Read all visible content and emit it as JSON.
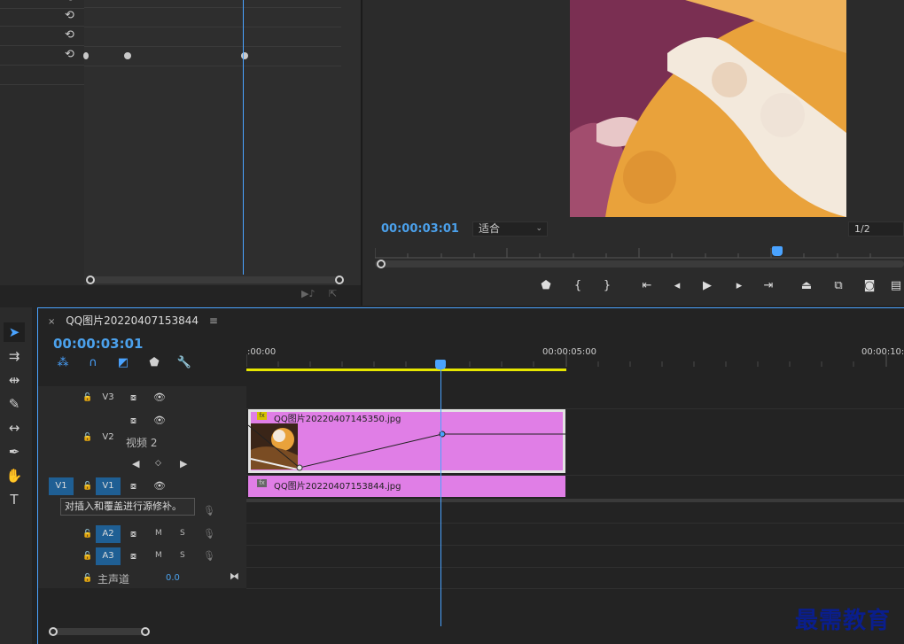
{
  "effect_controls": {
    "reset_icon": "reset-icon"
  },
  "program_monitor": {
    "timecode": "00:00:03:01",
    "fit": "适合",
    "resolution": "1/2",
    "buttons": [
      "marker-icon",
      "mark-in-icon",
      "mark-out-icon",
      "go-to-in-icon",
      "step-back-icon",
      "play-icon",
      "step-forward-icon",
      "go-to-out-icon",
      "lift-icon",
      "extract-icon",
      "export-frame-icon",
      "more-icon"
    ]
  },
  "timeline": {
    "tab_close": "×",
    "sequence_name": "QQ图片20220407153844",
    "tab_menu": "≡",
    "timecode": "00:00:03:01",
    "ruler": [
      ":00:00",
      "00:00:05:00",
      "00:00:10:0"
    ],
    "tracks": {
      "v3": "V3",
      "v2": "V2",
      "v2_name": "视频 2",
      "v1_source": "V1",
      "v1": "V1",
      "a2": "A2",
      "a3": "A3",
      "mute": "M",
      "solo": "S",
      "master": "主声道",
      "master_value": "0.0"
    },
    "clips": {
      "v2_clip": "QQ图片20220407145350.jpg",
      "v1_clip": "QQ图片20220407153844.jpg",
      "fx": "fx"
    },
    "tooltip": "对插入和覆盖进行源修补。"
  },
  "watermark": "最需教育"
}
